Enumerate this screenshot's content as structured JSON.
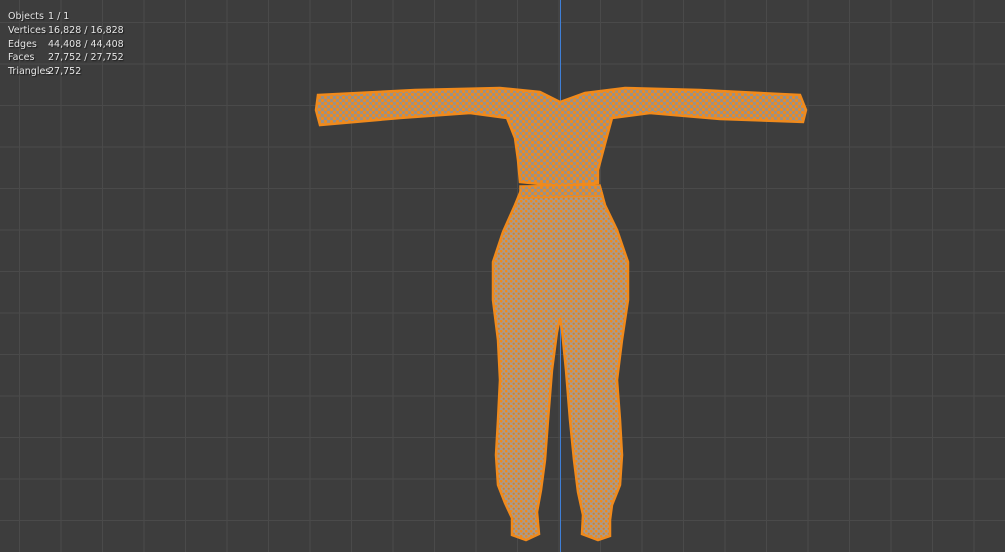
{
  "viewport": {
    "background_color": "#3d3d3d",
    "grid_color": "#4a4a4a",
    "axis_color": "#3f7fd6"
  },
  "stats": {
    "objects": {
      "label": "Objects",
      "value": "1 / 1"
    },
    "vertices": {
      "label": "Vertices",
      "value": "16,828 / 16,828"
    },
    "edges": {
      "label": "Edges",
      "value": "44,408 / 44,408"
    },
    "faces": {
      "label": "Faces",
      "value": "27,752 / 27,752"
    },
    "triangles": {
      "label": "Triangles",
      "value": "27,752"
    }
  },
  "model": {
    "selection_color": "#f08a1c",
    "mesh_color": "#9a9188"
  }
}
